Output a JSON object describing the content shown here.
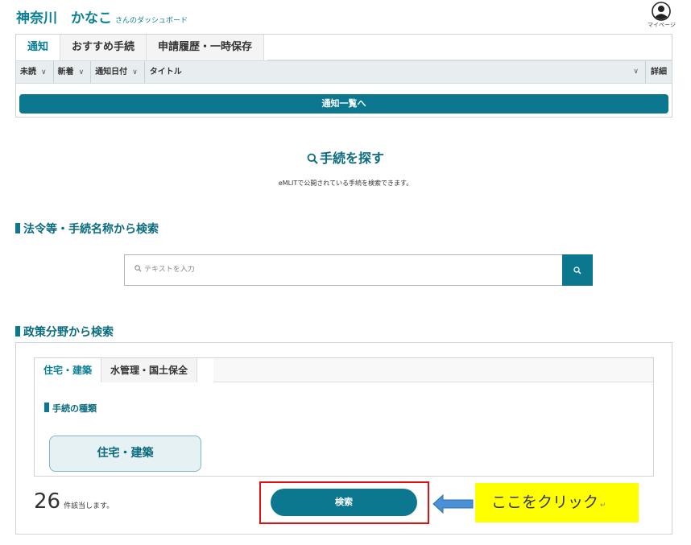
{
  "header": {
    "user_name": "神奈川　かなこ",
    "title_suffix": "さんのダッシュボード",
    "mypage_label": "マイページ"
  },
  "notice": {
    "tabs": [
      {
        "label": "通知",
        "active": true
      },
      {
        "label": "おすすめ手続",
        "active": false
      },
      {
        "label": "申請履歴・一時保存",
        "active": false
      }
    ],
    "filters": {
      "unread": "未読",
      "newest": "新着",
      "notice_date": "通知日付",
      "title": "タイトル",
      "detail": "詳細"
    },
    "list_button": "通知一覧へ"
  },
  "search": {
    "heading": "手続を探す",
    "description": "eMLITで公開されている手続を検索できます。",
    "keyword_section": "法令等・手続名称から検索",
    "placeholder": "テキストを入力"
  },
  "policy": {
    "section_title": "政策分野から検索",
    "tabs": [
      {
        "label": "住宅・建築",
        "active": true
      },
      {
        "label": "水管理・国土保全",
        "active": false
      }
    ],
    "kind_title": "手続の種類",
    "kind_chip": "住宅・建築",
    "result_count": "26",
    "result_unit": "件該当します。",
    "search_button": "検索"
  },
  "annotation": {
    "callout_text": "ここをクリック",
    "callout_mark": "↵",
    "frame_color": "#e01010",
    "callout_color": "#ffff00"
  },
  "colors": {
    "accent": "#0b7890",
    "heading": "#0b6b7e"
  }
}
